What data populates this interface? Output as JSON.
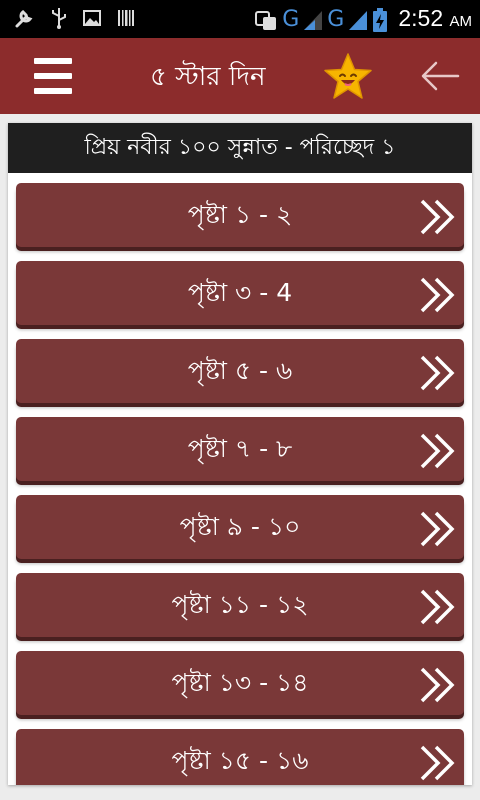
{
  "status_bar": {
    "network_1": "G",
    "network_2": "G",
    "time": "2:52",
    "ampm": "AM",
    "icons": [
      "wrench-icon",
      "usb-icon",
      "image-icon",
      "barcode-icon",
      "translate-icon",
      "signal-icon",
      "signal-icon",
      "battery-charging-icon"
    ]
  },
  "app_bar": {
    "title": "৫ স্টার দিন",
    "menu_icon": "hamburger-menu-icon",
    "star_icon": "smiling-star-icon",
    "back_icon": "arrow-left-icon",
    "background": "#8c2c2c"
  },
  "section": {
    "header": "প্রিয় নবীর ১০০ সুন্নাত - পরিচ্ছেদ ১"
  },
  "pages": [
    {
      "label": "পৃষ্টা ১ - ২"
    },
    {
      "label": "পৃষ্টা ৩ - 4"
    },
    {
      "label": "পৃষ্টা ৫ - ৬"
    },
    {
      "label": "পৃষ্টা ৭ - ৮"
    },
    {
      "label": "পৃষ্টা ৯ - ১০"
    },
    {
      "label": "পৃষ্টা ১১ - ১২"
    },
    {
      "label": "পৃষ্টা ১৩ - ১৪"
    },
    {
      "label": "পৃষ্টা ১৫ - ১৬"
    }
  ],
  "colors": {
    "item_bg": "#7a3838",
    "item_shadow": "#4a2020",
    "header_bg": "#1f1f1f",
    "network_letter": "#4a90d9"
  }
}
